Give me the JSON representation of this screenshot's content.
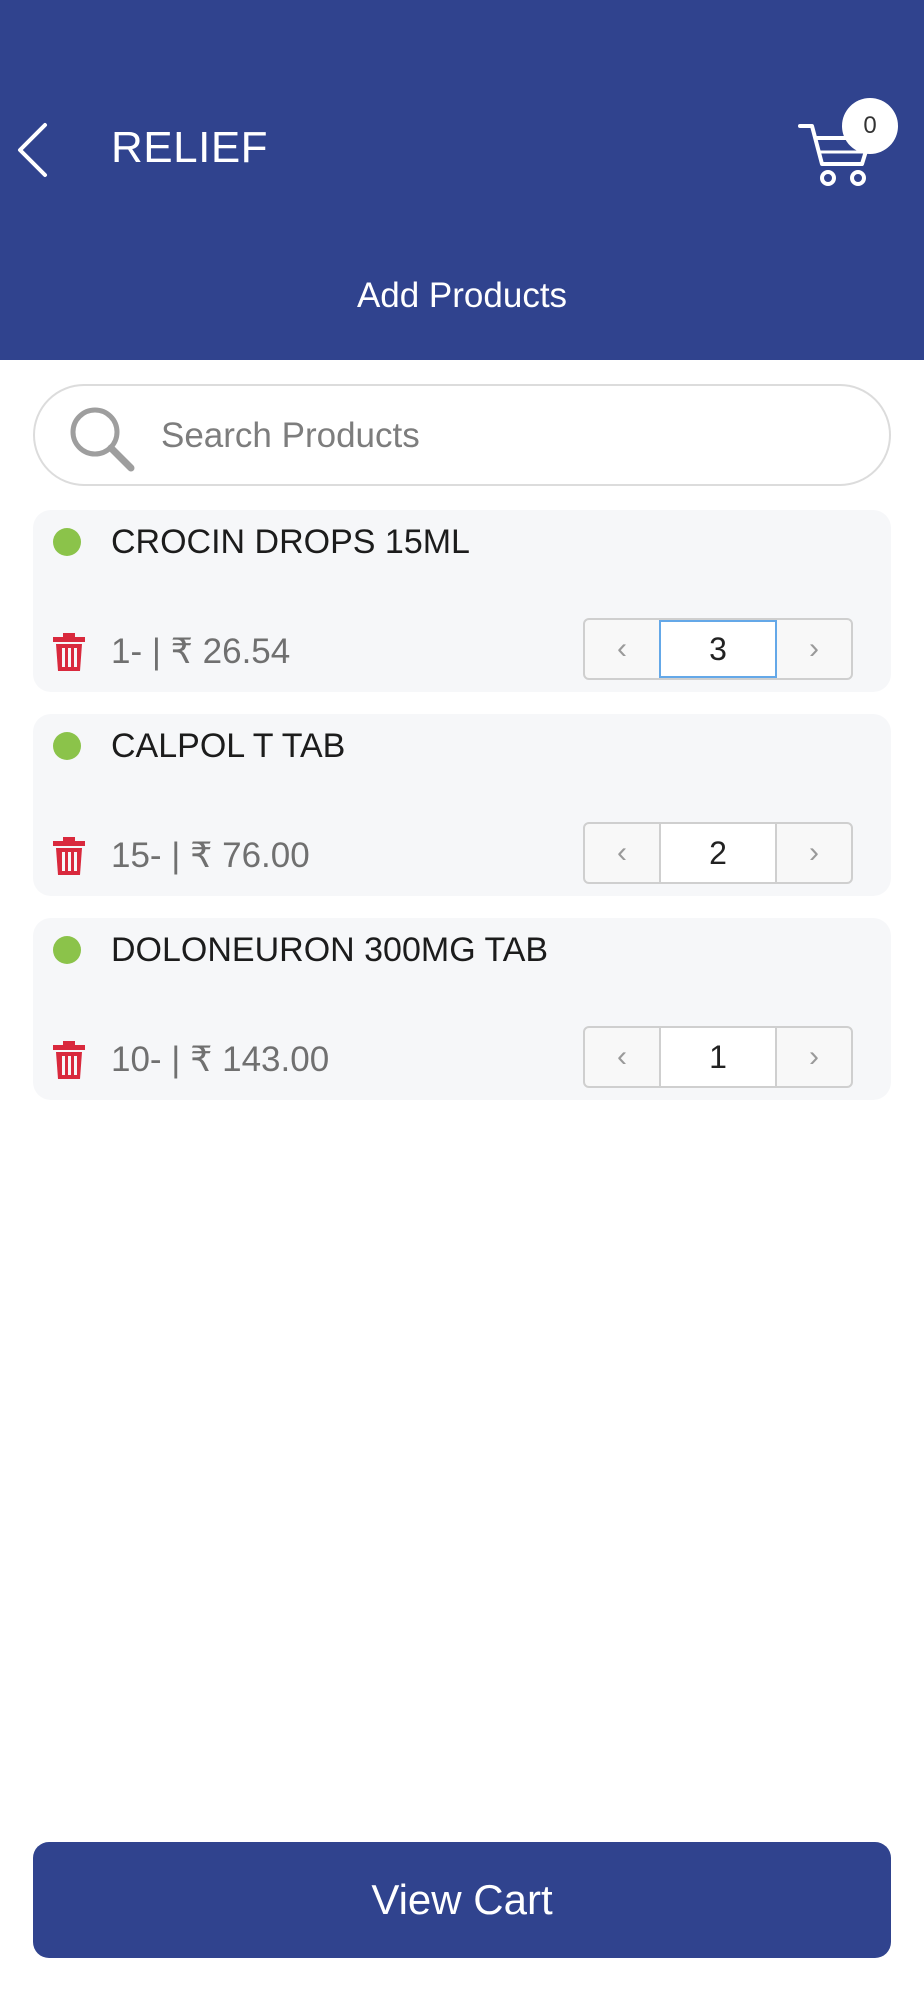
{
  "header": {
    "title": "RELIEF",
    "subtitle": "Add Products",
    "cart_count": "0",
    "bg_color": "#30438e"
  },
  "search": {
    "placeholder": "Search Products"
  },
  "products": [
    {
      "name": "CROCIN DROPS 15ML",
      "price_line": "1-  | ₹ 26.54",
      "quantity": "3",
      "status_color": "#8bc34a"
    },
    {
      "name": "CALPOL T TAB",
      "price_line": "15- | ₹ 76.00",
      "quantity": "2",
      "status_color": "#8bc34a"
    },
    {
      "name": "DOLONEURON 300MG TAB",
      "price_line": "10- | ₹ 143.00",
      "quantity": "1",
      "status_color": "#8bc34a"
    }
  ],
  "stepper": {
    "decrement_icon": "chevron-left-icon",
    "increment_icon": "chevron-right-icon"
  },
  "footer": {
    "view_cart_label": "View Cart"
  }
}
